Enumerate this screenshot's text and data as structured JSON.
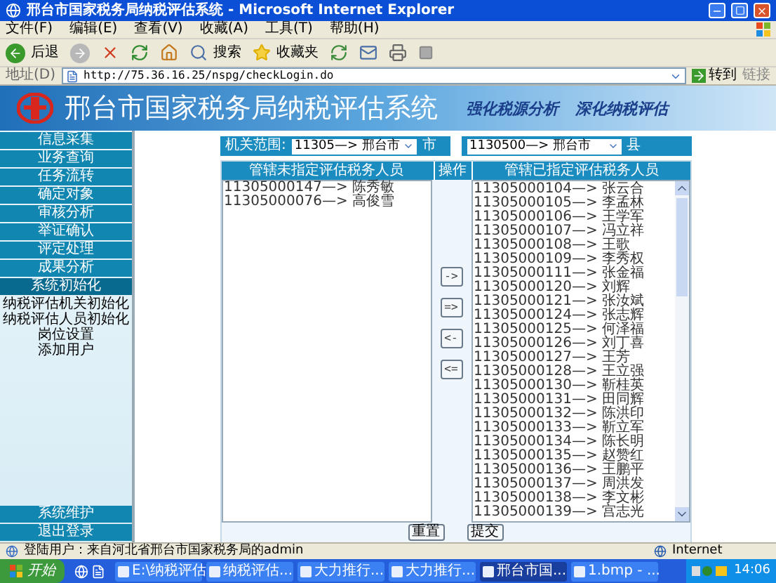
{
  "window": {
    "title": "邢台市国家税务局纳税评估系统 - Microsoft Internet Explorer"
  },
  "menu": [
    "文件(F)",
    "编辑(E)",
    "查看(V)",
    "收藏(A)",
    "工具(T)",
    "帮助(H)"
  ],
  "toolbar": {
    "back": "后退",
    "search": "搜索",
    "favorites": "收藏夹"
  },
  "address_bar": {
    "label": "地址(D)",
    "value": "http://75.36.16.25/nspg/checkLogin.do",
    "go": "转到",
    "links": "链接"
  },
  "banner": {
    "title": "邢台市国家税务局纳税评估系统",
    "slogan": [
      "强化税源分析",
      "深化纳税评估"
    ]
  },
  "sidebar": {
    "items": [
      {
        "label": "信息采集",
        "expanded": false
      },
      {
        "label": "业务查询",
        "expanded": false
      },
      {
        "label": "任务流转",
        "expanded": false
      },
      {
        "label": "确定对象",
        "expanded": false
      },
      {
        "label": "审核分析",
        "expanded": false
      },
      {
        "label": "举证确认",
        "expanded": false
      },
      {
        "label": "评定处理",
        "expanded": false
      },
      {
        "label": "成果分析",
        "expanded": false
      },
      {
        "label": "系统初始化",
        "expanded": true,
        "children": [
          "纳税评估机关初始化",
          "纳税评估人员初始化",
          "岗位设置",
          "添加用户"
        ]
      }
    ],
    "bottom_items": [
      "系统维护",
      "退出登录"
    ]
  },
  "filter": {
    "label": "机关范围:",
    "city_select": "11305—> 邢台市",
    "city_suffix": "市",
    "county_select": "1130500—> 邢台市",
    "county_suffix": "县"
  },
  "unassigned": {
    "header": "管辖未指定评估税务人员",
    "items": [
      "11305000147—> 陈秀敏",
      "11305000076—> 高俊雪"
    ]
  },
  "operations": {
    "header": "操作",
    "buttons": [
      "->",
      "=>",
      "<-",
      "<="
    ]
  },
  "assigned": {
    "header": "管辖已指定评估税务人员",
    "items": [
      "11305000104—> 张云合",
      "11305000105—> 李孟林",
      "11305000106—> 王学军",
      "11305000107—> 冯立祥",
      "11305000108—> 王歌",
      "11305000109—> 李秀权",
      "11305000111—> 张金福",
      "11305000120—> 刘辉",
      "11305000121—> 张汝斌",
      "11305000124—> 张志辉",
      "11305000125—> 何泽福",
      "11305000126—> 刘丁喜",
      "11305000127—> 王芳",
      "11305000128—> 王立强",
      "11305000130—> 靳桂英",
      "11305000131—> 田同辉",
      "11305000132—> 陈洪印",
      "11305000133—> 靳立军",
      "11305000134—> 陈长明",
      "11305000135—> 赵赞红",
      "11305000136—> 王鹏平",
      "11305000137—> 周洪发",
      "11305000138—> 李文彬",
      "11305000139—> 宫志光"
    ]
  },
  "form_buttons": [
    "重置",
    "提交"
  ],
  "status_bar": {
    "text": "登陆用户：来自河北省邢台市国家税务局的admin",
    "zone": "Internet"
  },
  "taskbar": {
    "start": "开始",
    "buttons": [
      {
        "label": "E:\\纳税评估",
        "selected": false
      },
      {
        "label": "纳税评估...",
        "selected": false
      },
      {
        "label": "大力推行...",
        "selected": false
      },
      {
        "label": "大力推行...",
        "selected": false
      },
      {
        "label": "邢台市国...",
        "selected": true
      },
      {
        "label": "1.bmp - ...",
        "selected": false
      }
    ],
    "time": "14:06"
  }
}
